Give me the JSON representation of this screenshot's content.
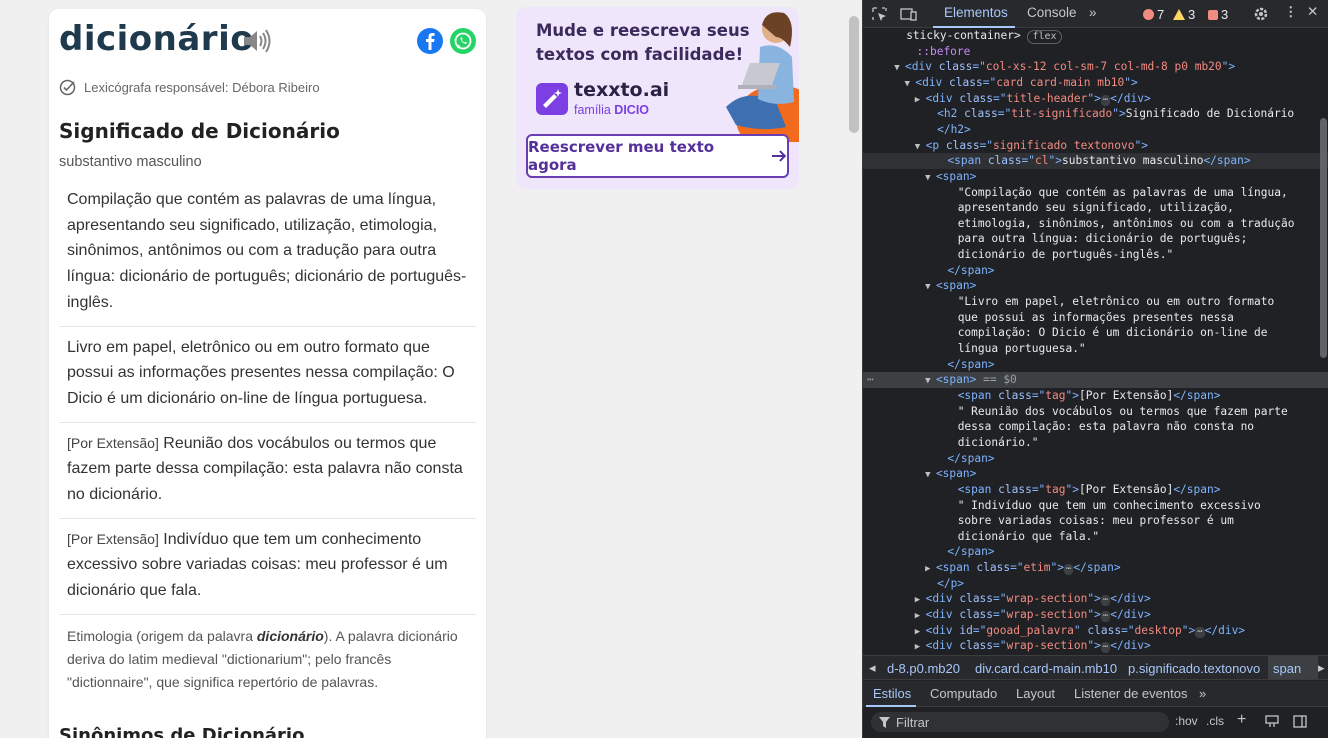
{
  "page": {
    "word": "dicionário",
    "lexicographer": "Lexicógrafa responsável: Débora Ribeiro",
    "heading": "Significado de Dicionário",
    "part_of_speech": "substantivo masculino",
    "definitions": [
      {
        "tag": "",
        "text": "Compilação que contém as palavras de uma língua, apresentando seu significado, utilização, etimologia, sinônimos, antônimos ou com a tradução para outra língua: dicionário de português; dicionário de português-inglês."
      },
      {
        "tag": "",
        "text": "Livro em papel, eletrônico ou em outro formato que possui as informações presentes nessa compilação: O Dicio é um dicionário on-line de língua portuguesa."
      },
      {
        "tag": "[Por Extensão]",
        "text": " Reunião dos vocábulos ou termos que fazem parte dessa compilação: esta palavra não consta no dicionário."
      },
      {
        "tag": "[Por Extensão]",
        "text": " Indivíduo que tem um conhecimento excessivo sobre variadas coisas: meu professor é um dicionário que fala."
      }
    ],
    "etymology": {
      "prefix": "Etimologia (origem da palavra ",
      "word": "dicionário",
      "suffix": "). A palavra dicionário deriva do latim medieval \"dictionarium\"; pelo francês \"dictionnaire\", que significa repertório de palavras."
    },
    "synonyms_heading": "Sinônimos de Dicionário",
    "ad": {
      "headline": "Mude e reescreva seus textos com facilidade!",
      "brand": "texxto.ai",
      "family_prefix": "família ",
      "family_brand": "DICIO",
      "button": "Reescrever meu texto agora",
      "accent": "#6b3fb4"
    },
    "icons": [
      "speaker-icon",
      "facebook-icon",
      "whatsapp-icon",
      "check-circle-icon",
      "arrow-right-icon"
    ]
  },
  "devtools": {
    "tabs": [
      "Elementos",
      "Console"
    ],
    "active_tab": "Elementos",
    "errors": "7",
    "warnings": "3",
    "issues": "3",
    "tree": [
      {
        "indent": 4,
        "text": "sticky-container>",
        "pill": "flex"
      },
      {
        "indent": 5,
        "pseudo": "::before"
      },
      {
        "indent": 4,
        "arrow": "▼",
        "open": "div",
        "attrs": [
          [
            "class",
            "col-xs-12 col-sm-7 col-md-8 p0 mb20"
          ]
        ]
      },
      {
        "indent": 5,
        "arrow": "▼",
        "open": "div",
        "attrs": [
          [
            "class",
            "card card-main mb10"
          ]
        ]
      },
      {
        "indent": 6,
        "arrow": "▶",
        "open": "div",
        "attrs": [
          [
            "class",
            "title-header"
          ]
        ],
        "collapsed": "div"
      },
      {
        "indent": 7,
        "open": "h2",
        "attrs": [
          [
            "class",
            "tit-significado"
          ]
        ],
        "text": "Significado de Dicionário"
      },
      {
        "indent": 7,
        "close": "h2"
      },
      {
        "indent": 6,
        "arrow": "▼",
        "open": "p",
        "attrs": [
          [
            "class",
            "significado textonovo"
          ]
        ]
      },
      {
        "indent": 8,
        "open": "span",
        "attrs": [
          [
            "class",
            "cl"
          ]
        ],
        "text": "substantivo masculino",
        "endtag": "span",
        "hover": true
      },
      {
        "indent": 7,
        "arrow": "▼",
        "open": "span"
      },
      {
        "indent": 9,
        "raw": "\"Compilação que contém as palavras de uma língua,"
      },
      {
        "indent": 9,
        "raw": "apresentando seu significado, utilização,"
      },
      {
        "indent": 9,
        "raw": "etimologia, sinônimos, antônimos ou com a tradução"
      },
      {
        "indent": 9,
        "raw": "para outra língua: dicionário de português;"
      },
      {
        "indent": 9,
        "raw": "dicionário de português-inglês.\""
      },
      {
        "indent": 8,
        "close": "span"
      },
      {
        "indent": 7,
        "arrow": "▼",
        "open": "span"
      },
      {
        "indent": 9,
        "raw": "\"Livro em papel, eletrônico ou em outro formato"
      },
      {
        "indent": 9,
        "raw": "que possui as informações presentes nessa"
      },
      {
        "indent": 9,
        "raw": "compilação: O Dicio é um dicionário on-line de"
      },
      {
        "indent": 9,
        "raw": "língua portuguesa.\""
      },
      {
        "indent": 8,
        "close": "span"
      },
      {
        "indent": 7,
        "arrow": "▼",
        "open": "span",
        "selected": true,
        "suffix": " == $0"
      },
      {
        "indent": 9,
        "open": "span",
        "attrs": [
          [
            "class",
            "tag"
          ]
        ],
        "text": "[Por Extensão]",
        "endtag": "span"
      },
      {
        "indent": 9,
        "raw": "\" Reunião dos vocábulos ou termos que fazem parte"
      },
      {
        "indent": 9,
        "raw": "dessa compilação: esta palavra não consta no"
      },
      {
        "indent": 9,
        "raw": "dicionário.\""
      },
      {
        "indent": 8,
        "close": "span"
      },
      {
        "indent": 7,
        "arrow": "▼",
        "open": "span"
      },
      {
        "indent": 9,
        "open": "span",
        "attrs": [
          [
            "class",
            "tag"
          ]
        ],
        "text": "[Por Extensão]",
        "endtag": "span"
      },
      {
        "indent": 9,
        "raw": "\" Indivíduo que tem um conhecimento excessivo"
      },
      {
        "indent": 9,
        "raw": "sobre variadas coisas: meu professor é um"
      },
      {
        "indent": 9,
        "raw": "dicionário que fala.\""
      },
      {
        "indent": 8,
        "close": "span"
      },
      {
        "indent": 7,
        "arrow": "▶",
        "open": "span",
        "attrs": [
          [
            "class",
            "etim"
          ]
        ],
        "collapsed": "span"
      },
      {
        "indent": 7,
        "close": "p"
      },
      {
        "indent": 6,
        "arrow": "▶",
        "open": "div",
        "attrs": [
          [
            "class",
            "wrap-section"
          ]
        ],
        "collapsed": "div"
      },
      {
        "indent": 6,
        "arrow": "▶",
        "open": "div",
        "attrs": [
          [
            "class",
            "wrap-section"
          ]
        ],
        "collapsed": "div"
      },
      {
        "indent": 6,
        "arrow": "▶",
        "open": "div",
        "attrs": [
          [
            "id",
            "gooad_palavra"
          ],
          [
            "class",
            "desktop"
          ]
        ],
        "collapsed": "div"
      },
      {
        "indent": 6,
        "arrow": "▶",
        "open": "div",
        "attrs": [
          [
            "class",
            "wrap-section"
          ]
        ],
        "collapsed": "div"
      }
    ],
    "breadcrumbs": [
      "d-8.p0.mb20",
      "div.card.card-main.mb10",
      "p.significado.textonovo",
      "span"
    ],
    "style_tabs": [
      "Estilos",
      "Computado",
      "Layout",
      "Listener de eventos"
    ],
    "active_style_tab": "Estilos",
    "filter_placeholder": "Filtrar",
    "filter_hov": ":hov",
    "filter_cls": ".cls"
  }
}
